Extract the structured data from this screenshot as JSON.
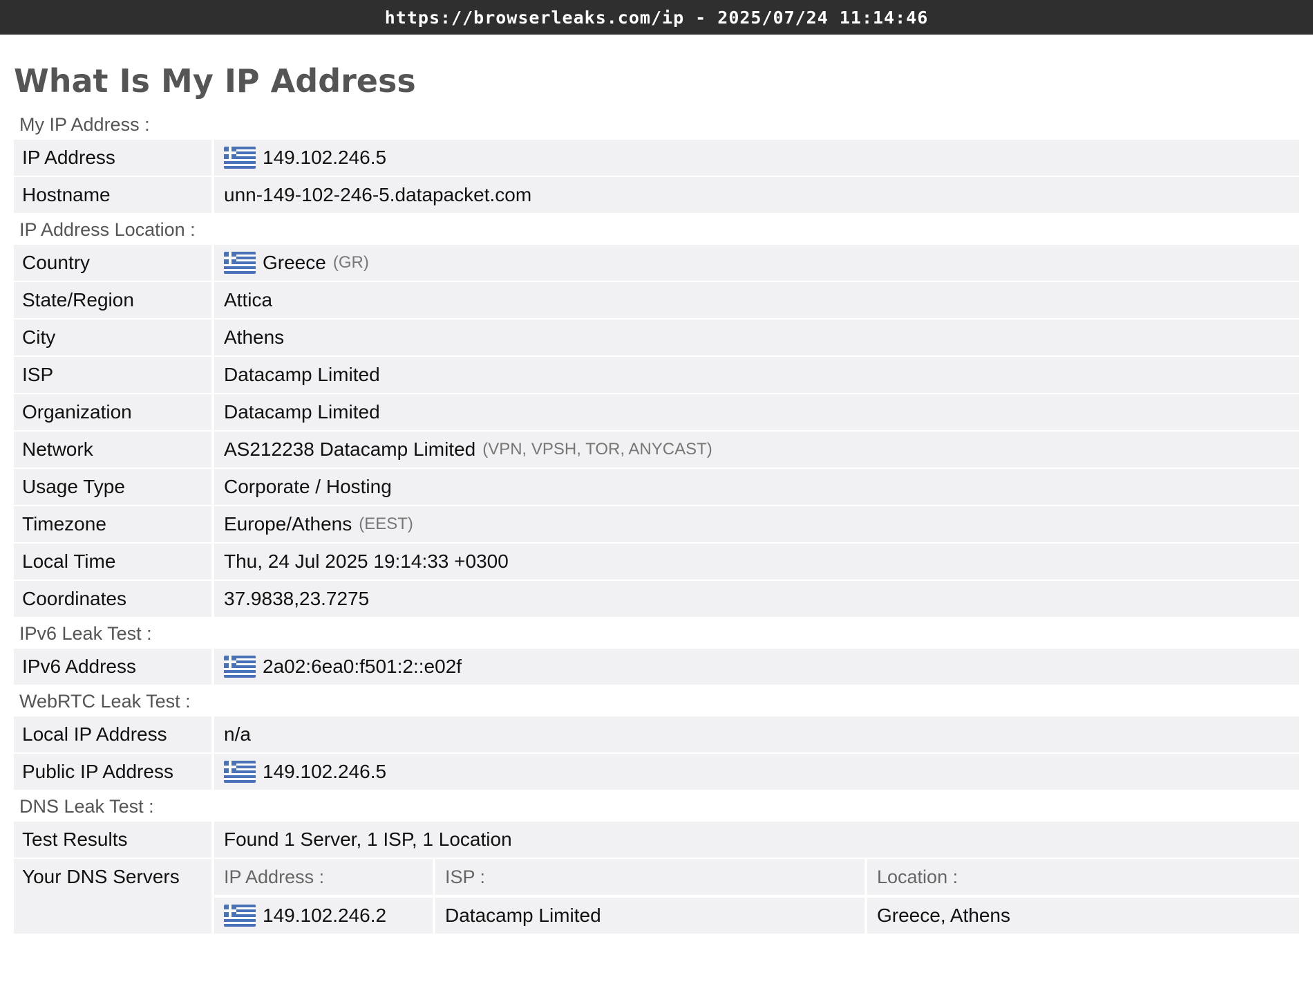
{
  "topbar": {
    "text": "https://browserleaks.com/ip - 2025/07/24 11:14:46"
  },
  "page": {
    "title": "What Is My IP Address"
  },
  "my_ip": {
    "heading": "My IP Address :",
    "ip_label": "IP Address",
    "ip_value": "149.102.246.5",
    "hostname_label": "Hostname",
    "hostname_value": "unn-149-102-246-5.datapacket.com"
  },
  "location": {
    "heading": "IP Address Location :",
    "country_label": "Country",
    "country_value": "Greece",
    "country_code": "(GR)",
    "region_label": "State/Region",
    "region_value": "Attica",
    "city_label": "City",
    "city_value": "Athens",
    "isp_label": "ISP",
    "isp_value": "Datacamp Limited",
    "org_label": "Organization",
    "org_value": "Datacamp Limited",
    "network_label": "Network",
    "network_value": "AS212238 Datacamp Limited",
    "network_tags": "(VPN, VPSH, TOR, ANYCAST)",
    "usage_label": "Usage Type",
    "usage_value": "Corporate / Hosting",
    "tz_label": "Timezone",
    "tz_value": "Europe/Athens",
    "tz_abbr": "(EEST)",
    "localtime_label": "Local Time",
    "localtime_value": "Thu, 24 Jul 2025 19:14:33 +0300",
    "coords_label": "Coordinates",
    "coords_value": "37.9838,23.7275"
  },
  "ipv6": {
    "heading": "IPv6 Leak Test :",
    "label": "IPv6 Address",
    "value": "2a02:6ea0:f501:2::e02f"
  },
  "webrtc": {
    "heading": "WebRTC Leak Test :",
    "local_label": "Local IP Address",
    "local_value": "n/a",
    "public_label": "Public IP Address",
    "public_value": "149.102.246.5"
  },
  "dns": {
    "heading": "DNS Leak Test :",
    "results_label": "Test Results",
    "results_value": "Found 1 Server, 1 ISP, 1 Location",
    "servers_label": "Your DNS Servers",
    "col_ip": "IP Address :",
    "col_isp": "ISP :",
    "col_location": "Location :",
    "server_ip": "149.102.246.2",
    "server_isp": "Datacamp Limited",
    "server_location": "Greece, Athens"
  },
  "colors": {
    "topbar": "#2f2f2f",
    "row_bg": "#f1f1f3",
    "heading": "#555555"
  },
  "icons": {
    "flag": "greece-flag-icon"
  }
}
